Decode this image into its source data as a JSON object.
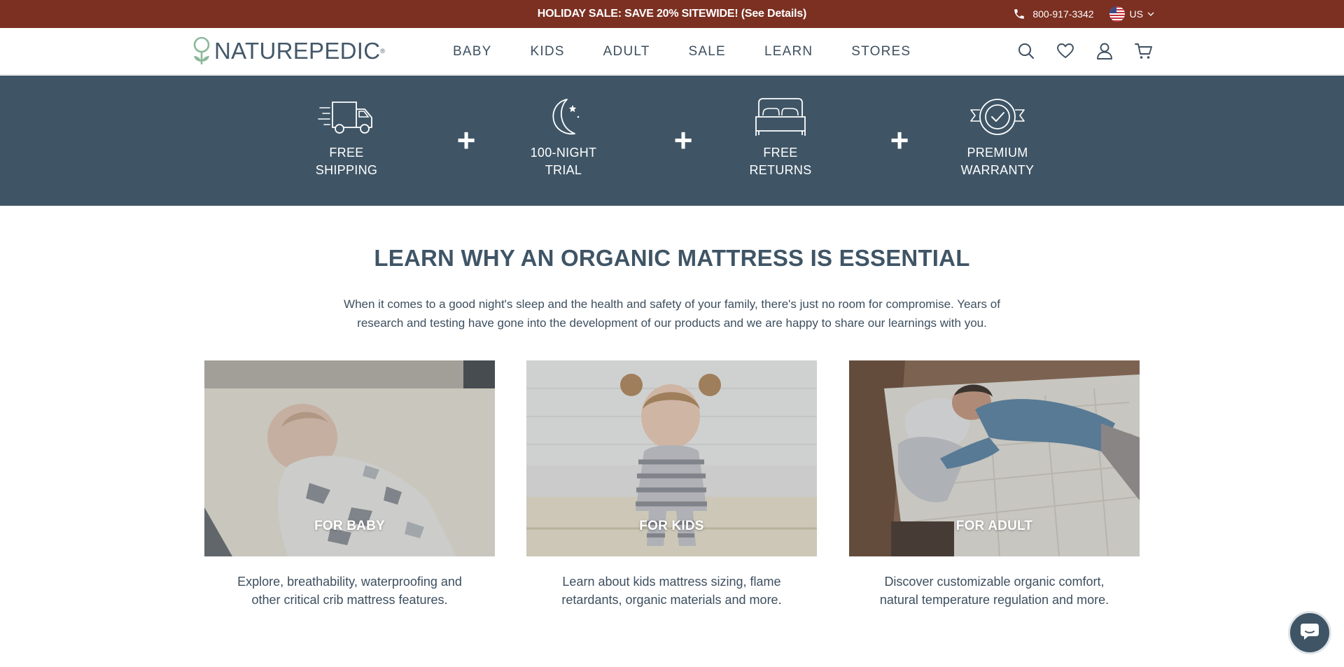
{
  "promo": {
    "text": "HOLIDAY SALE: SAVE 20% SITEWIDE! (See Details)",
    "phone": "800-917-3342",
    "region": "US",
    "phone_icon": "phone-icon",
    "flag_icon": "us-flag-icon"
  },
  "header": {
    "logo_text": "NATUREPEDIC",
    "logo_reg": "®",
    "nav": [
      "BABY",
      "KIDS",
      "ADULT",
      "SALE",
      "LEARN",
      "STORES"
    ],
    "icons": [
      "search-icon",
      "heart-icon",
      "account-icon",
      "cart-icon"
    ]
  },
  "benefits": [
    {
      "line1": "FREE",
      "line2": "SHIPPING",
      "icon": "truck-icon"
    },
    {
      "line1": "100-NIGHT",
      "line2": "TRIAL",
      "icon": "moon-icon"
    },
    {
      "line1": "FREE",
      "line2": "RETURNS",
      "icon": "bed-icon"
    },
    {
      "line1": "PREMIUM",
      "line2": "WARRANTY",
      "icon": "badge-check-icon"
    }
  ],
  "learn": {
    "title": "LEARN WHY AN ORGANIC MATTRESS IS ESSENTIAL",
    "desc_line1": "When it comes to a good night's sleep and the health and safety of your family, there's just no room for compromise. Years of",
    "desc_line2": "research and testing have gone into the development of our products and we are happy to share our learnings with you."
  },
  "cards": [
    {
      "label": "FOR BABY",
      "desc1": "Explore, breathability, waterproofing and",
      "desc2": "other critical crib mattress features."
    },
    {
      "label": "FOR KIDS",
      "desc1": "Learn about kids mattress sizing, flame",
      "desc2": "retardants, organic materials and more."
    },
    {
      "label": "FOR ADULT",
      "desc1": "Discover customizable organic comfort,",
      "desc2": "natural temperature regulation and more."
    }
  ],
  "colors": {
    "promo_bg": "#7b3022",
    "benefits_bg": "#3f5566",
    "text": "#3d4f5f",
    "logo_green": "#8cb79a"
  }
}
